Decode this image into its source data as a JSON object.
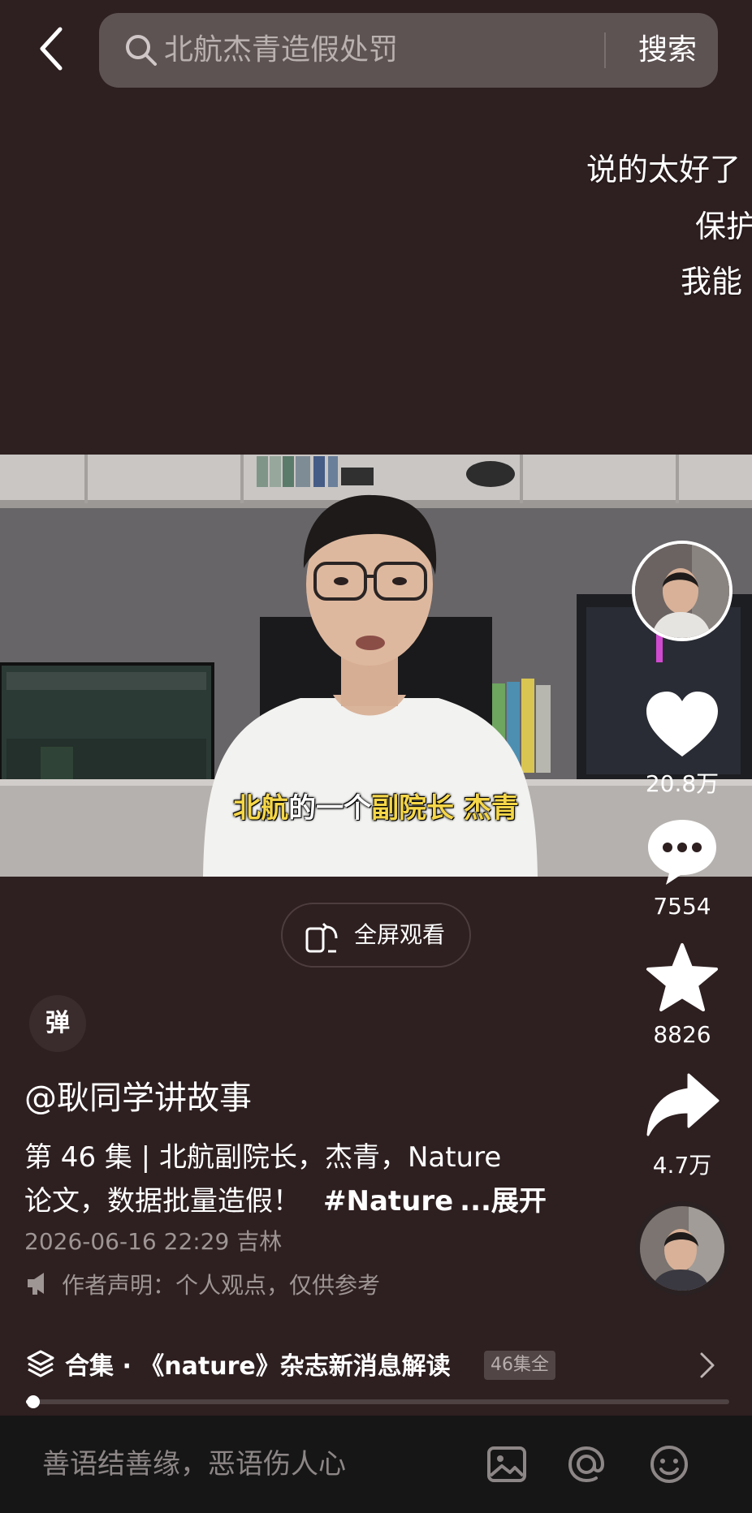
{
  "search": {
    "query": "北航杰青造假处罚",
    "button_label": "搜索"
  },
  "danmaku": [
    "说的太好了",
    "保护",
    "我能"
  ],
  "video": {
    "subtitle_parts": [
      {
        "text": "北航",
        "highlight": true
      },
      {
        "text": "的一个",
        "highlight": false
      },
      {
        "text": "副院长",
        "highlight": true
      },
      {
        "text": " ",
        "highlight": false
      },
      {
        "text": "杰青",
        "highlight": true
      }
    ],
    "fullscreen_label": "全屏观看"
  },
  "rail": {
    "likes": "20.8万",
    "comments": "7554",
    "favorites": "8826",
    "shares": "4.7万"
  },
  "danmaku_toggle": "弹",
  "post": {
    "author": "@耿同学讲故事",
    "caption_line1": "第 46 集 | 北航副院长，杰青，Nature",
    "caption_line2": "论文，数据批量造假！",
    "hashtag": "#Nature",
    "expand_label": "...展开",
    "meta": "2026-06-16 22:29 吉林",
    "disclaimer": "作者声明：个人观点，仅供参考"
  },
  "collection": {
    "label": "合集 · 《nature》杂志新消息解读",
    "badge": "46集全"
  },
  "progress": {
    "fraction": 0.01
  },
  "comment_bar": {
    "placeholder": "善语结善缘，恶语伤人心"
  },
  "colors": {
    "background": "#2e1f20",
    "subtitle_highlight": "#f5d648",
    "bottom_bar": "#161616"
  }
}
